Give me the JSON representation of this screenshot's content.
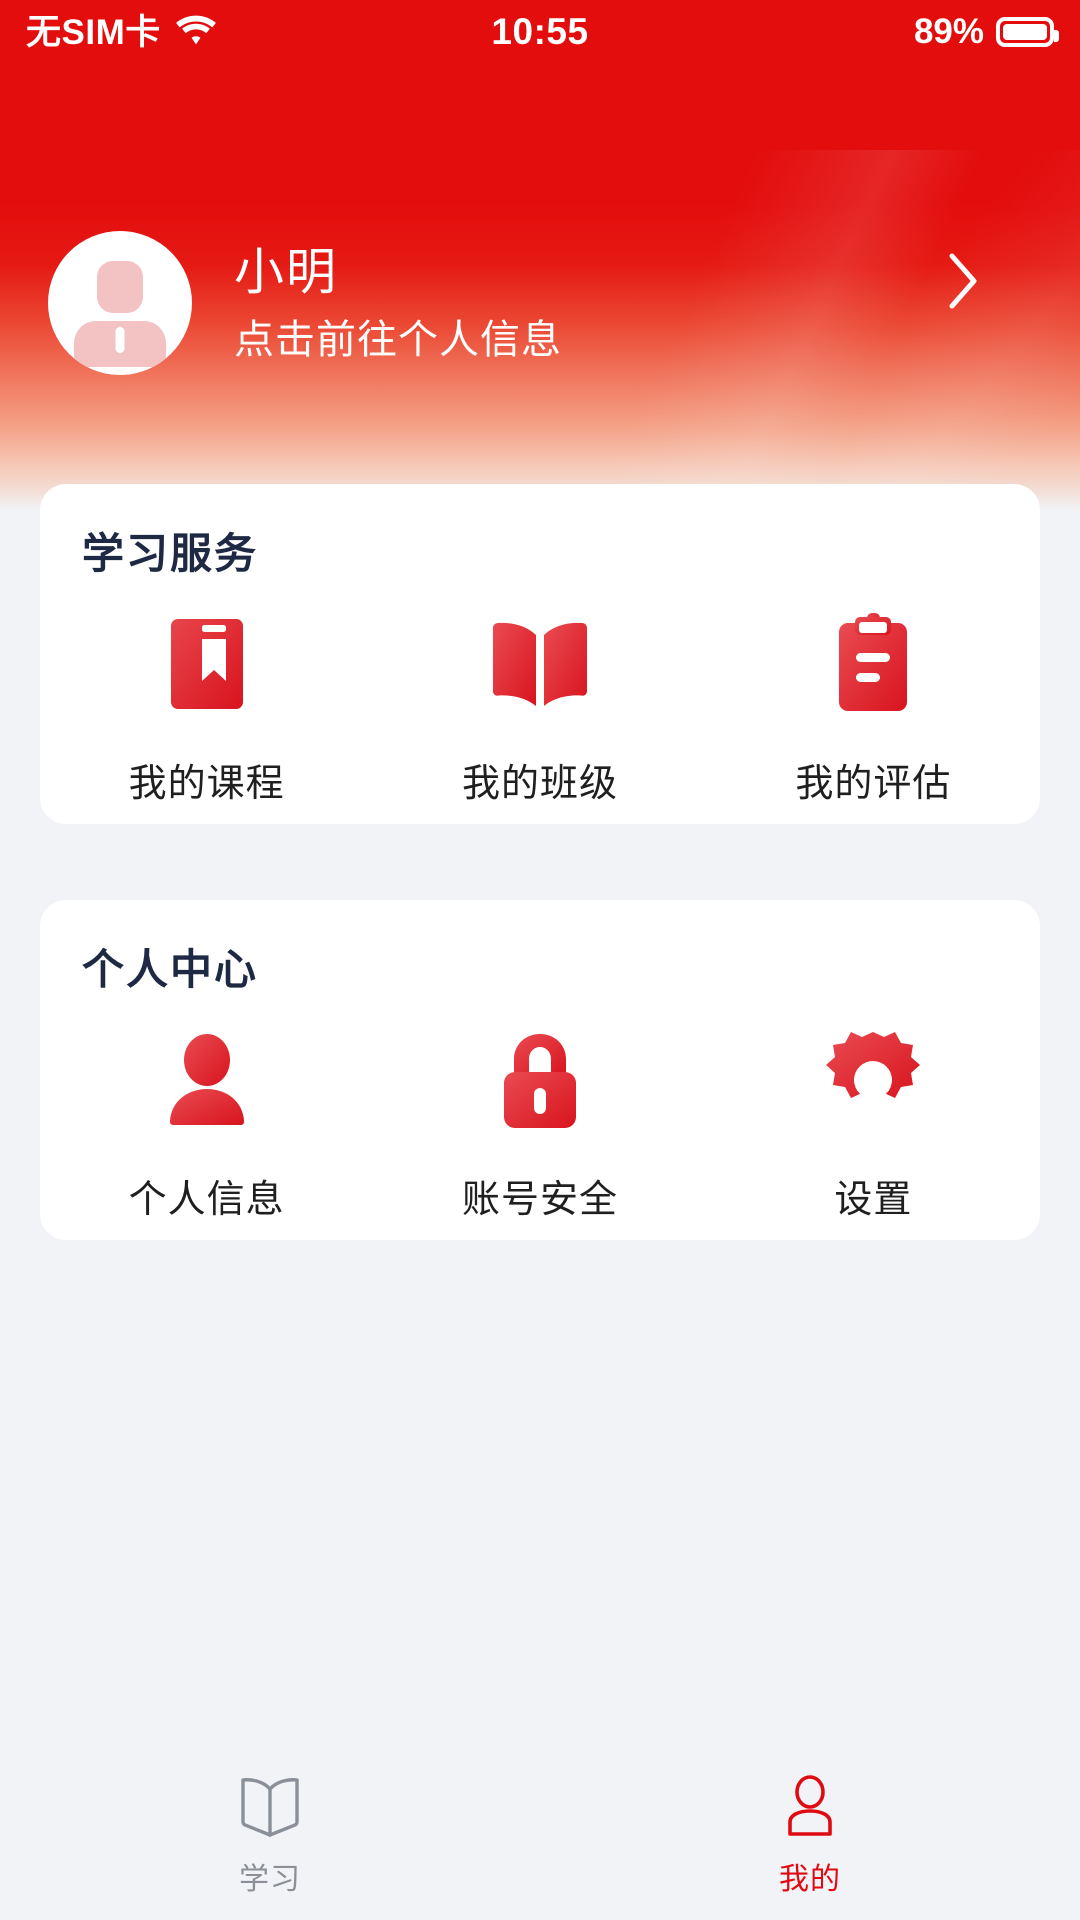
{
  "status_bar": {
    "carrier": "无SIM卡",
    "wifi_icon": "wifi-icon",
    "time": "10:55",
    "battery_percent": "89%",
    "battery_icon": "battery-icon"
  },
  "header": {
    "background_color": "#e30d0d",
    "gradient_end_color": "#f2f3f7",
    "avatar_icon": "avatar-placeholder-icon",
    "name": "小明",
    "subtitle": "点击前往个人信息",
    "chevron_icon": "chevron-right-icon"
  },
  "cards": [
    {
      "title": "学习服务",
      "items": [
        {
          "icon": "book-bookmark-icon",
          "label": "我的课程"
        },
        {
          "icon": "open-book-icon",
          "label": "我的班级"
        },
        {
          "icon": "clipboard-icon",
          "label": "我的评估"
        }
      ]
    },
    {
      "title": "个人中心",
      "items": [
        {
          "icon": "user-icon",
          "label": "个人信息"
        },
        {
          "icon": "lock-icon",
          "label": "账号安全"
        },
        {
          "icon": "gear-icon",
          "label": "设置"
        }
      ]
    }
  ],
  "tab_bar": {
    "tabs": [
      {
        "icon": "open-book-outline-icon",
        "label": "学习",
        "active": false,
        "color": "#8a8f98"
      },
      {
        "icon": "user-outline-icon",
        "label": "我的",
        "active": true,
        "color": "#e00b12"
      }
    ]
  },
  "colors": {
    "brand_red": "#e30d0d",
    "icon_red": "#e3353c",
    "page_background": "#f2f3f7",
    "card_background": "#ffffff",
    "title_navy": "#1e2a44",
    "label_dark": "#1f1f1f"
  }
}
